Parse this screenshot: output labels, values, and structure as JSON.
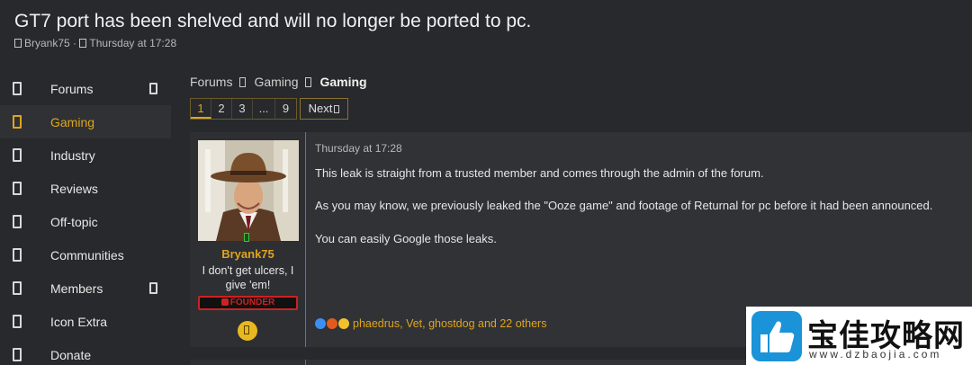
{
  "thread": {
    "title": "GT7 port has been shelved and will no longer be ported to pc.",
    "author": "Bryank75",
    "date": "Thursday at 17:28"
  },
  "sidebar": {
    "items": [
      {
        "label": "Forums",
        "active": false,
        "has_toggle": true
      },
      {
        "label": "Gaming",
        "active": true,
        "has_toggle": false
      },
      {
        "label": "Industry",
        "active": false,
        "has_toggle": false
      },
      {
        "label": "Reviews",
        "active": false,
        "has_toggle": false
      },
      {
        "label": "Off-topic",
        "active": false,
        "has_toggle": false
      },
      {
        "label": "Communities",
        "active": false,
        "has_toggle": false
      },
      {
        "label": "Members",
        "active": false,
        "has_toggle": true
      },
      {
        "label": "Icon Extra",
        "active": false,
        "has_toggle": false
      },
      {
        "label": "Donate",
        "active": false,
        "has_toggle": false
      }
    ]
  },
  "breadcrumb": {
    "items": [
      "Forums",
      "Gaming",
      "Gaming"
    ]
  },
  "pagination": {
    "pages": [
      "1",
      "2",
      "3",
      "...",
      "9"
    ],
    "current": "1",
    "next_label": "Next"
  },
  "post": {
    "time": "Thursday at 17:28",
    "paragraphs": [
      "This leak is straight from a trusted member and comes through the admin of the forum.",
      "As you may know, we previously leaked the \"Ooze game\" and footage of Returnal for pc before it had been announced.",
      "You can easily Google those leaks."
    ],
    "reactions": {
      "text": "phaedrus, Vet, ghostdog and 22 others",
      "icons": [
        "like-emoji",
        "fire-emoji",
        "haha-emoji"
      ]
    }
  },
  "user": {
    "name": "Bryank75",
    "title": "I don't get ulcers, I give 'em!",
    "badge": "FOUNDER"
  },
  "watermark": {
    "title": "宝佳攻略网",
    "url": "www.dzbaojia.com"
  },
  "colors": {
    "accent": "#e0a51c",
    "background": "#27292c",
    "post_bg": "#303236",
    "founder_red": "#cc2222"
  }
}
